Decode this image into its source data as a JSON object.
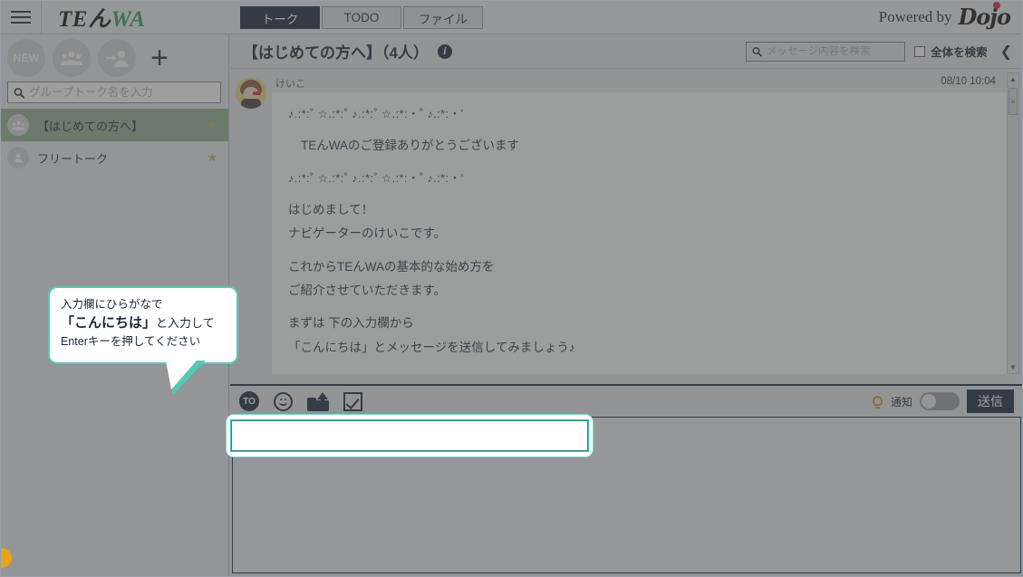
{
  "topbar": {
    "menu_icon": "hamburger-icon",
    "brand": {
      "te": "TE",
      "n": "ん",
      "wa": "WA"
    },
    "tabs": [
      {
        "label": "トーク",
        "active": true
      },
      {
        "label": "TODO",
        "active": false
      },
      {
        "label": "ファイル",
        "active": false
      }
    ],
    "powered_by": "Powered by",
    "powered_brand": "Dojo"
  },
  "sidebar": {
    "actions": [
      {
        "name": "new-talk-button",
        "label": "NEW"
      },
      {
        "name": "group-talk-button",
        "label": ""
      },
      {
        "name": "invite-user-button",
        "label": ""
      },
      {
        "name": "add-button",
        "label": "+"
      }
    ],
    "search": {
      "placeholder": "グループトーク名を入力",
      "value": "",
      "icon": "search-icon"
    },
    "talks": [
      {
        "name": "【はじめての方へ】",
        "selected": true,
        "starred": true,
        "avatar": "group-avatar"
      },
      {
        "name": "フリートーク",
        "selected": false,
        "starred": true,
        "avatar": "user-avatar"
      }
    ],
    "star_glyph": "★"
  },
  "chat": {
    "title": "【はじめての方へ】（4人）",
    "info_icon_label": "i",
    "search": {
      "placeholder": "メッセージ内容を検索",
      "value": ""
    },
    "search_all": {
      "label": "全体を検索",
      "checked": false
    },
    "collapse_glyph": "❮",
    "timestamp": "08/10 10:04",
    "message": {
      "sender": "けいこ",
      "lines": [
        {
          "type": "deco",
          "text": "♪.:*:˚  ☆.:*:˚  ♪.:*:˚  ☆.:*:・˚  ♪.:*:・'"
        },
        {
          "type": "blank",
          "text": ""
        },
        {
          "type": "indent",
          "text": "TEんWAのご登録ありがとうございます"
        },
        {
          "type": "blank",
          "text": ""
        },
        {
          "type": "deco",
          "text": "♪.:*:˚  ☆.:*:˚  ♪.:*:˚  ☆.:*:・˚  ♪.:*:・'"
        },
        {
          "type": "blank",
          "text": ""
        },
        {
          "type": "text",
          "text": "はじめまして！"
        },
        {
          "type": "text",
          "text": "ナビゲーターのけいこです。"
        },
        {
          "type": "blank",
          "text": ""
        },
        {
          "type": "text",
          "text": "これからTEんWAの基本的な始め方を"
        },
        {
          "type": "text",
          "text": "ご紹介させていただきます。"
        },
        {
          "type": "blank",
          "text": ""
        },
        {
          "type": "text",
          "text": "まずは 下の入力欄から"
        },
        {
          "type": "text",
          "text": "「こんにちは」とメッセージを送信してみましょう♪"
        }
      ]
    },
    "scrollbar": {
      "up_glyph": "▲",
      "down_glyph": "▼",
      "thumb_glyph": "≡"
    }
  },
  "composer": {
    "tools": [
      {
        "name": "to-icon",
        "label": "TO"
      },
      {
        "name": "emoji-icon",
        "label": ""
      },
      {
        "name": "file-upload-icon",
        "label": ""
      },
      {
        "name": "todo-checkbox-icon",
        "label": ""
      }
    ],
    "notify": {
      "icon": "bell-icon",
      "label": "通知",
      "enabled": false
    },
    "send_label": "送信",
    "input": {
      "value": "",
      "placeholder": ""
    }
  },
  "callout": {
    "line1": "入力欄にひらがなで",
    "line2_bold": "「こんにちは」",
    "line2_rest": "と入力して",
    "line3": "Enterキーを押してください"
  },
  "colors": {
    "accent_navy": "#13263c",
    "brand_green": "#2f9e5e",
    "callout_border": "#55c9b4",
    "selected_talk": "#8fb08f",
    "bell_orange": "#d69a1f",
    "corner_dot": "#e8a317",
    "dojo_red": "#d3242a"
  }
}
